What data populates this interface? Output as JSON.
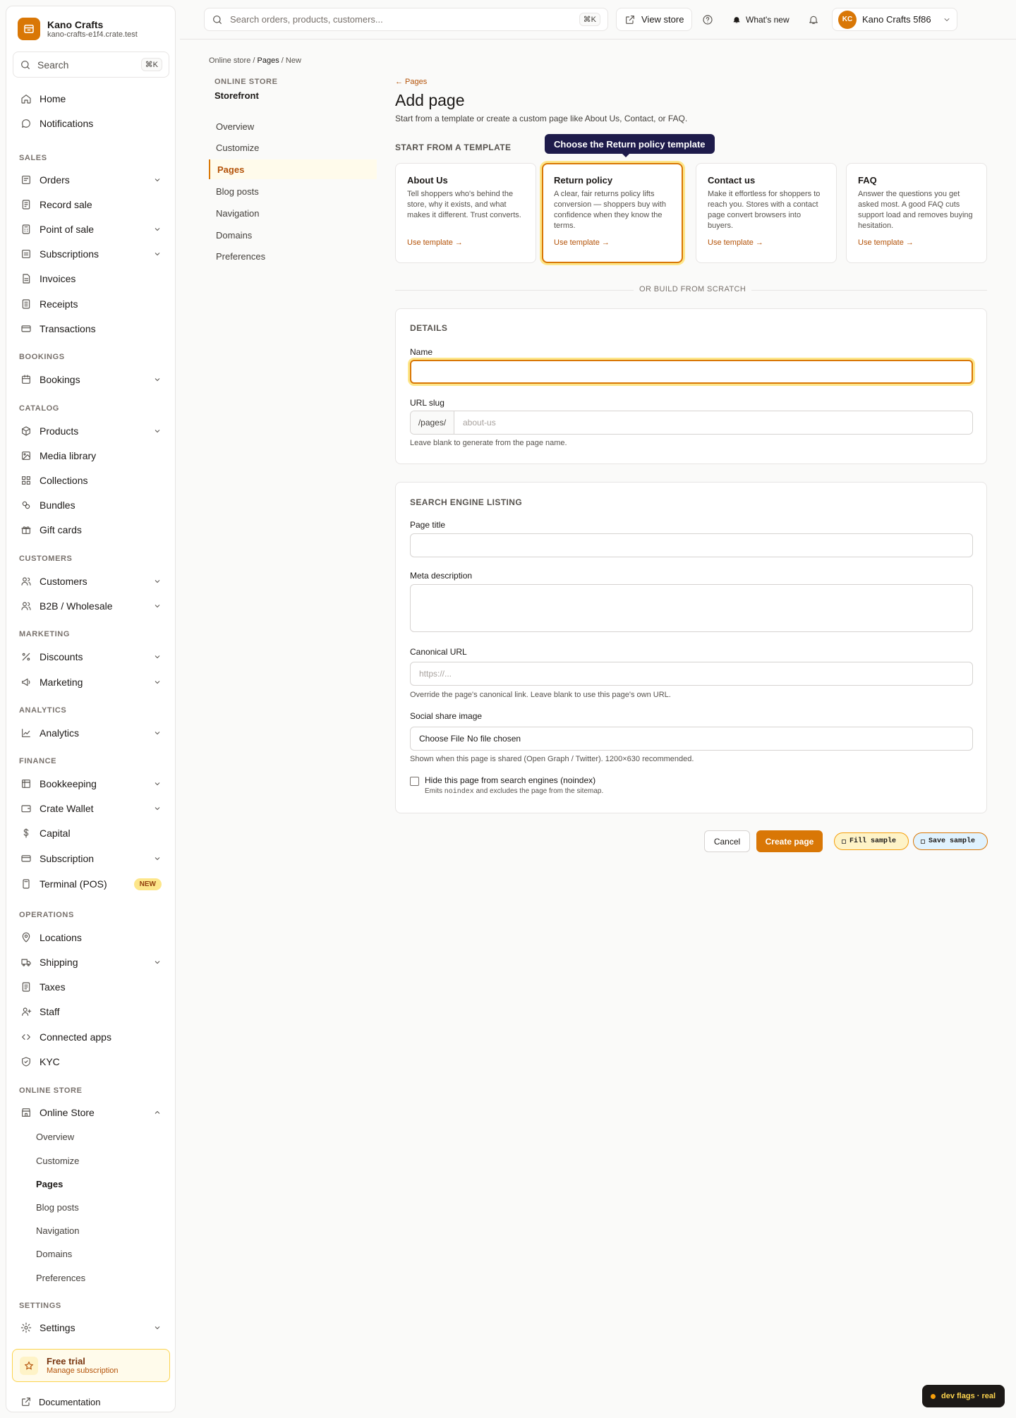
{
  "brand": {
    "name": "Kano Crafts",
    "domain": "kano-crafts-e1f4.crate.test"
  },
  "sidebar": {
    "search_placeholder": "Search",
    "search_shortcut": "⌘K",
    "home": "Home",
    "notifications": "Notifications",
    "sections": {
      "sales": "SALES",
      "bookings": "BOOKINGS",
      "catalog": "CATALOG",
      "customers": "CUSTOMERS",
      "marketing": "MARKETING",
      "analytics": "ANALYTICS",
      "finance": "FINANCE",
      "operations": "OPERATIONS",
      "online_store": "ONLINE STORE",
      "settings": "SETTINGS"
    },
    "items": {
      "orders": "Orders",
      "record_sale": "Record sale",
      "pos": "Point of sale",
      "subscriptions": "Subscriptions",
      "invoices": "Invoices",
      "receipts": "Receipts",
      "transactions": "Transactions",
      "bookings": "Bookings",
      "products": "Products",
      "media": "Media library",
      "collections": "Collections",
      "bundles": "Bundles",
      "gift_cards": "Gift cards",
      "customers": "Customers",
      "b2b": "B2B / Wholesale",
      "discounts": "Discounts",
      "marketing": "Marketing",
      "analytics": "Analytics",
      "bookkeeping": "Bookkeeping",
      "wallet": "Crate Wallet",
      "capital": "Capital",
      "subscription": "Subscription",
      "terminal": "Terminal (POS)",
      "terminal_badge": "NEW",
      "locations": "Locations",
      "shipping": "Shipping",
      "taxes": "Taxes",
      "staff": "Staff",
      "apps": "Connected apps",
      "kyc": "KYC",
      "online_store": "Online Store",
      "settings": "Settings"
    },
    "online_store_sub": [
      "Overview",
      "Customize",
      "Pages",
      "Blog posts",
      "Navigation",
      "Domains",
      "Preferences"
    ],
    "trial": {
      "title": "Free trial",
      "link": "Manage subscription"
    },
    "docs": "Documentation"
  },
  "topbar": {
    "search_placeholder": "Search orders, products, customers...",
    "search_shortcut": "⌘K",
    "view_store": "View store",
    "whats_new": "What's new",
    "account_initials": "KC",
    "account_name": "Kano Crafts 5f86"
  },
  "breadcrumb": {
    "root": "Online store",
    "sep": "/",
    "mid": "Pages",
    "current": "New"
  },
  "subnav": {
    "eyebrow": "ONLINE STORE",
    "title": "Storefront",
    "items": [
      "Overview",
      "Customize",
      "Pages",
      "Blog posts",
      "Navigation",
      "Domains",
      "Preferences"
    ]
  },
  "page": {
    "back": "← Pages",
    "title": "Add page",
    "description": "Start from a template or create a custom page like About Us, Contact, or FAQ.",
    "template_heading": "START FROM A TEMPLATE",
    "tooltip": "Choose the Return policy template",
    "templates": [
      {
        "title": "About Us",
        "desc": "Tell shoppers who's behind the store, why it exists, and what makes it different. Trust converts.",
        "link": "Use template →"
      },
      {
        "title": "Return policy",
        "desc": "A clear, fair returns policy lifts conversion — shoppers buy with confidence when they know the terms.",
        "link": "Use template →"
      },
      {
        "title": "Contact us",
        "desc": "Make it effortless for shoppers to reach you. Stores with a contact page convert browsers into buyers.",
        "link": "Use template →"
      },
      {
        "title": "FAQ",
        "desc": "Answer the questions you get asked most. A good FAQ cuts support load and removes buying hesitation.",
        "link": "Use template →"
      }
    ],
    "divider": "OR BUILD FROM SCRATCH"
  },
  "details": {
    "heading": "DETAILS",
    "name_label": "Name",
    "name_value": "",
    "slug_label": "URL slug",
    "slug_prefix": "/pages/",
    "slug_placeholder": "about-us",
    "slug_help": "Leave blank to generate from the page name."
  },
  "seo": {
    "heading": "SEARCH ENGINE LISTING",
    "title_label": "Page title",
    "meta_label": "Meta description",
    "canonical_label": "Canonical URL",
    "canonical_placeholder": "https://...",
    "canonical_help": "Override the page's canonical link. Leave blank to use this page's own URL.",
    "image_label": "Social share image",
    "file_button": "Choose File",
    "file_status": "No file chosen",
    "image_help": "Shown when this page is shared (Open Graph / Twitter). 1200×630 recommended.",
    "noindex_label": "Hide this page from search engines (noindex)",
    "noindex_help_pre": "Emits",
    "noindex_help_code": "noindex",
    "noindex_help_post": "and excludes the page from the sitemap."
  },
  "actions": {
    "cancel": "Cancel",
    "create": "Create page",
    "fill_sample": "Fill sample",
    "save_sample": "Save sample"
  },
  "devflags": "dev flags · real",
  "colors": {
    "accent": "#d97706",
    "tooltip": "#1e1b4b"
  }
}
